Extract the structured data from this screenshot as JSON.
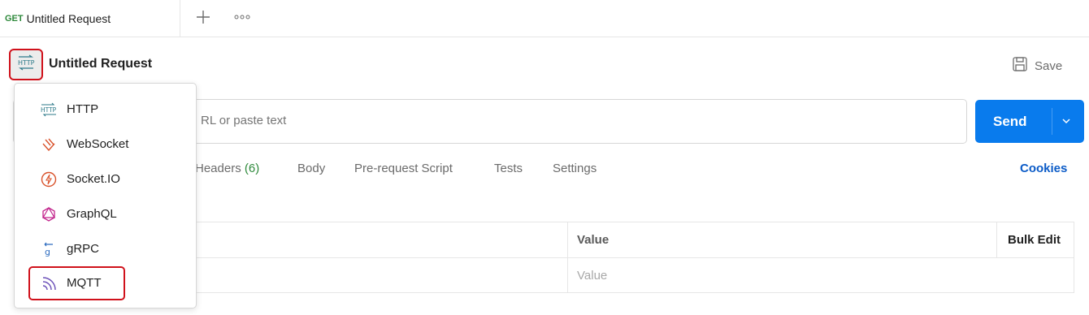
{
  "tab": {
    "method": "GET",
    "title": "Untitled Request"
  },
  "header": {
    "title": "Untitled Request",
    "save_label": "Save"
  },
  "url": {
    "placeholder": "RL or paste text"
  },
  "send": {
    "label": "Send"
  },
  "request_tabs": [
    {
      "label": "Headers",
      "count": "(6)"
    },
    {
      "label": "Body"
    },
    {
      "label": "Pre-request Script"
    },
    {
      "label": "Tests"
    },
    {
      "label": "Settings"
    }
  ],
  "cookies_label": "Cookies",
  "table": {
    "headers": {
      "value": "Value",
      "bulk_edit": "Bulk Edit"
    },
    "row_placeholder": {
      "value": "Value"
    }
  },
  "menu": {
    "items": [
      {
        "label": "HTTP",
        "icon": "http-icon"
      },
      {
        "label": "WebSocket",
        "icon": "websocket-icon"
      },
      {
        "label": "Socket.IO",
        "icon": "socketio-icon"
      },
      {
        "label": "GraphQL",
        "icon": "graphql-icon"
      },
      {
        "label": "gRPC",
        "icon": "grpc-icon"
      },
      {
        "label": "MQTT",
        "icon": "mqtt-icon"
      }
    ]
  },
  "colors": {
    "accent": "#097bed",
    "highlight_outline": "#d0111b",
    "method_get": "#2f8a3c",
    "link": "#0b5bc7"
  }
}
